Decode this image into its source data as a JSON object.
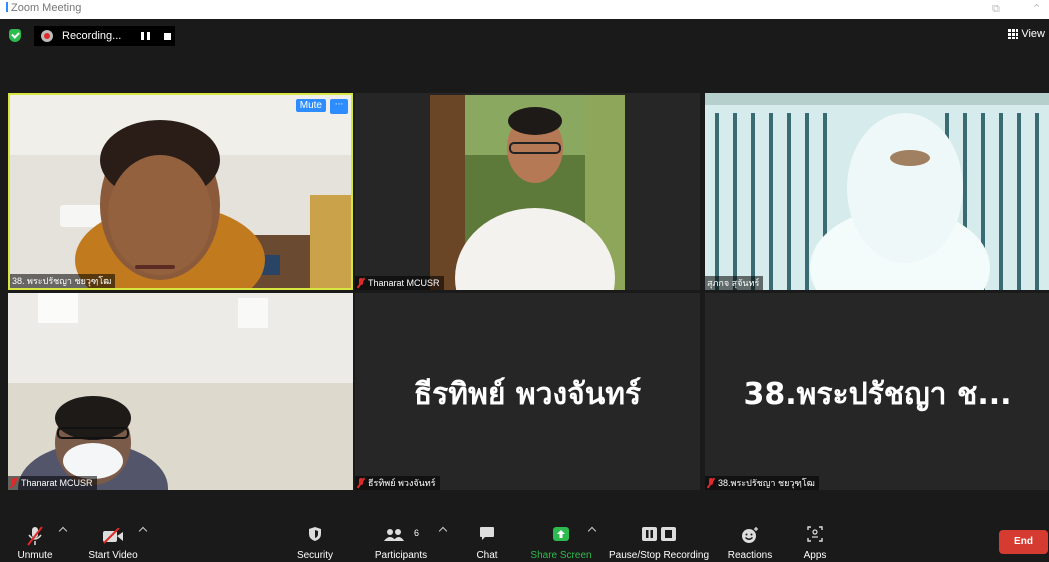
{
  "window": {
    "title": "Zoom Meeting"
  },
  "recording": {
    "label": "Recording..."
  },
  "view": {
    "label": "View"
  },
  "tiles": [
    {
      "name": "38. พระปรัชญา ชยวุฑฺโฒ",
      "active_speaker": true,
      "mute_label": "Mute",
      "more_label": "···"
    },
    {
      "name": "Thanarat MCUSR",
      "muted": true
    },
    {
      "name": "สุภกจ สุจันทร์"
    },
    {
      "name": "Thanarat MCUSR",
      "muted": true
    },
    {
      "name": "ธีรทิพย์ พวงจันทร์",
      "big_name": "ธีรทิพย์ พวงจันทร์",
      "muted": true
    },
    {
      "name": "38.พระปรัชญา ชยวุฑฺโฒ",
      "big_name": "38.พระปรัชญา ช...",
      "muted": true
    }
  ],
  "toolbar": {
    "unmute": "Unmute",
    "start_video": "Start Video",
    "security": "Security",
    "participants": "Participants",
    "participants_count": "6",
    "chat": "Chat",
    "share_screen": "Share Screen",
    "pause_stop_recording": "Pause/Stop Recording",
    "reactions": "Reactions",
    "apps": "Apps",
    "end": "End"
  },
  "colors": {
    "accent": "#2d8cff",
    "share_green": "#2dbb4f",
    "end_red": "#d63b32",
    "active_speaker_border": "#d7e640",
    "muted_red": "#e02828"
  }
}
